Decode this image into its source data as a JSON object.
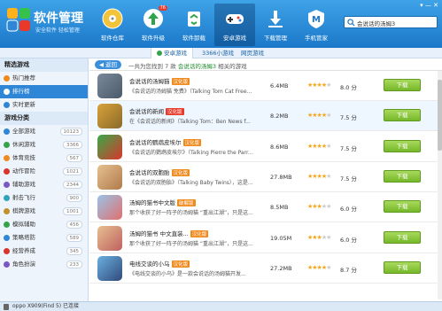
{
  "app": {
    "title": "软件管理",
    "subtitle": "安全软件 轻松管理"
  },
  "nav": [
    {
      "label": "软件仓库",
      "icon": "disc-icon",
      "badge": ""
    },
    {
      "label": "软件升级",
      "icon": "upgrade-icon",
      "badge": "76"
    },
    {
      "label": "软件卸载",
      "icon": "recycle-icon",
      "badge": ""
    },
    {
      "label": "安卓游戏",
      "icon": "gamepad-icon",
      "badge": ""
    },
    {
      "label": "下载管理",
      "icon": "download-icon",
      "badge": ""
    },
    {
      "label": "手机管家",
      "icon": "phone-manager-icon",
      "badge": ""
    }
  ],
  "search": {
    "value": "会说话的汤姆3"
  },
  "tabs": {
    "android": "安卓游戏",
    "small": "3366小游戏",
    "web": "网页游戏"
  },
  "sidebar": {
    "section1": "精选游戏",
    "featured": [
      {
        "label": "热门推荐",
        "color": "#f08a1c"
      },
      {
        "label": "排行榜",
        "color": "#ffffff"
      },
      {
        "label": "实时更新",
        "color": "#2f86d6"
      }
    ],
    "section2": "游戏分类",
    "categories": [
      {
        "label": "全部游戏",
        "count": "10123",
        "color": "#2f86d6"
      },
      {
        "label": "休闲游戏",
        "count": "3366",
        "color": "#36a34a"
      },
      {
        "label": "体育竞技",
        "count": "567",
        "color": "#f08a1c"
      },
      {
        "label": "动作冒险",
        "count": "1021",
        "color": "#d9362b"
      },
      {
        "label": "辅助游戏",
        "count": "2344",
        "color": "#7a57c4"
      },
      {
        "label": "射击飞行",
        "count": "900",
        "color": "#2fa3b8"
      },
      {
        "label": "棋牌游戏",
        "count": "1001",
        "color": "#c4902a"
      },
      {
        "label": "模拟辅助",
        "count": "456",
        "color": "#36a34a"
      },
      {
        "label": "策略塔防",
        "count": "589",
        "color": "#2f86d6"
      },
      {
        "label": "经营养成",
        "count": "345",
        "color": "#d9362b"
      },
      {
        "label": "角色扮演",
        "count": "233",
        "color": "#7a57c4"
      }
    ]
  },
  "main": {
    "back": "返回",
    "result_prefix": "一共为您找到 7 款",
    "result_keyword": "会说话的汤姆3",
    "result_suffix": "相关的游戏"
  },
  "results": [
    {
      "name": "会说话的汤姆猫",
      "tag": "汉化版",
      "tag_color": "#f08a1c",
      "desc": "《会说话的汤姆猫 免费》（Talking Tom Cat Free...",
      "size": "6.4MB",
      "rating": 4,
      "score": "8.0 分",
      "download": "下载"
    },
    {
      "name": "会说话的新闻",
      "tag": "汉化版",
      "tag_color": "#e8392b",
      "desc": "在《会说话的新闻》（Talking Tom：Ben News f...",
      "size": "8.2MB",
      "rating": 4,
      "score": "7.5 分",
      "download": "下载"
    },
    {
      "name": "会说话的鹦鹉皮埃尔",
      "tag": "汉化版",
      "tag_color": "#f08a1c",
      "desc": "《会说话的鹦鹉皮埃尔》（Talking Pierre the Parr...",
      "size": "8.6MB",
      "rating": 4,
      "score": "7.5 分",
      "download": "下载"
    },
    {
      "name": "会说话的双胞胎",
      "tag": "汉化版",
      "tag_color": "#f08a1c",
      "desc": "《会说话的双胞胎》（Talking Baby Twins），这是...",
      "size": "27.8MB",
      "rating": 4,
      "score": "7.5 分",
      "download": "下载"
    },
    {
      "name": "汤姆的猫书中文版",
      "tag": "破解版",
      "tag_color": "#f08a1c",
      "desc": "那个收获了好一阵子的汤姆猫 “重出江湖”，只是这...",
      "size": "8.5MB",
      "rating": 3,
      "score": "6.0 分",
      "download": "下载"
    },
    {
      "name": "汤姆的猫书 中文直装...",
      "tag": "汉化版",
      "tag_color": "#f08a1c",
      "desc": "那个收获了好一阵子的汤姆猫 “重出江湖”，只是这...",
      "size": "19.05M",
      "rating": 3,
      "score": "6.0 分",
      "download": "下载"
    },
    {
      "name": "电线交谈的小乌",
      "tag": "汉化版",
      "tag_color": "#f08a1c",
      "desc": "《电线交谈的小乌》是一款会说话的汤姆猫开发...",
      "size": "27.2MB",
      "rating": 4,
      "score": "8.7 分",
      "download": "下载"
    }
  ],
  "status": {
    "device": "oppo X909(Find 5) 已连接"
  }
}
